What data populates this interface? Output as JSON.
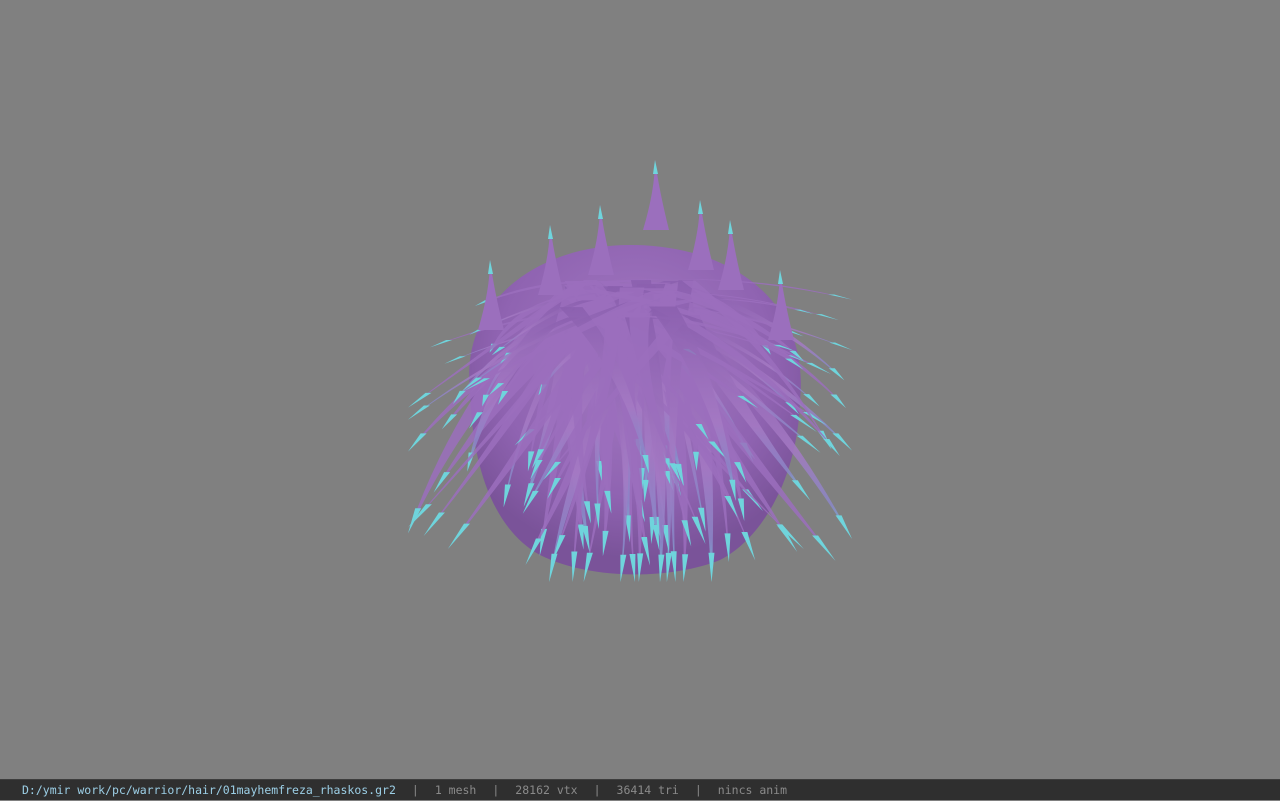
{
  "viewport": {
    "background": "#808080",
    "model": {
      "icon": "hair-mesh-icon",
      "hair_color": "#9b6fbd",
      "tip_color": "#6fd4dc"
    }
  },
  "status": {
    "file_path": "D:/ymir work/pc/warrior/hair/01mayhemfreza_rhaskos.gr2",
    "separator": "|",
    "mesh_count": "1 mesh",
    "vertex_count": "28162 vtx",
    "triangle_count": "36414 tri",
    "animation": "nincs anim"
  }
}
